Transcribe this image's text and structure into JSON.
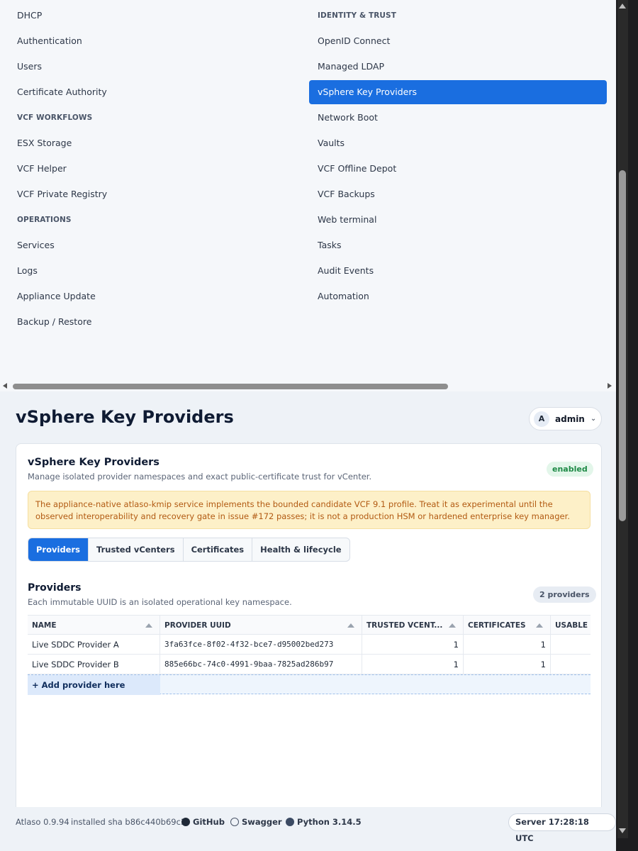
{
  "menu": {
    "left": [
      {
        "label": "DHCP",
        "type": "item"
      },
      {
        "label": "Authentication",
        "type": "item"
      },
      {
        "label": "Users",
        "type": "item"
      },
      {
        "label": "Certificate Authority",
        "type": "item"
      },
      {
        "label": "VCF WORKFLOWS",
        "type": "heading"
      },
      {
        "label": "ESX Storage",
        "type": "item"
      },
      {
        "label": "VCF Helper",
        "type": "item"
      },
      {
        "label": "VCF Private Registry",
        "type": "item"
      },
      {
        "label": "OPERATIONS",
        "type": "heading"
      },
      {
        "label": "Services",
        "type": "item"
      },
      {
        "label": "Logs",
        "type": "item"
      },
      {
        "label": "Appliance Update",
        "type": "item"
      },
      {
        "label": "Backup / Restore",
        "type": "item"
      }
    ],
    "right": [
      {
        "label": "IDENTITY & TRUST",
        "type": "heading"
      },
      {
        "label": "OpenID Connect",
        "type": "item"
      },
      {
        "label": "Managed LDAP",
        "type": "item"
      },
      {
        "label": "vSphere Key Providers",
        "type": "active"
      },
      {
        "label": "Network Boot",
        "type": "item"
      },
      {
        "label": "Vaults",
        "type": "item"
      },
      {
        "label": "VCF Offline Depot",
        "type": "item"
      },
      {
        "label": "VCF Backups",
        "type": "item"
      },
      {
        "label": "Web terminal",
        "type": "item"
      },
      {
        "label": "Tasks",
        "type": "item"
      },
      {
        "label": "Audit Events",
        "type": "item"
      },
      {
        "label": "Automation",
        "type": "item"
      }
    ]
  },
  "header": {
    "title": "vSphere Key Providers",
    "user_initial": "A",
    "user_name": "admin"
  },
  "card": {
    "title": "vSphere Key Providers",
    "subtitle": "Manage isolated provider namespaces and exact public-certificate trust for vCenter.",
    "status": "enabled",
    "warning": "The appliance-native atlaso-kmip service implements the bounded candidate VCF 9.1 profile. Treat it as experimental until the observed interoperability and recovery gate in issue #172 passes; it is not a production HSM or hardened enterprise key manager.",
    "tabs": [
      "Providers",
      "Trusted vCenters",
      "Certificates",
      "Health & lifecycle"
    ],
    "active_tab": 0
  },
  "providers": {
    "title": "Providers",
    "subtitle": "Each immutable UUID is an isolated operational key namespace.",
    "count": "2 providers",
    "columns": [
      "NAME",
      "PROVIDER UUID",
      "TRUSTED VCENT...",
      "CERTIFICATES",
      "USABLE"
    ],
    "rows": [
      [
        "Live SDDC Provider A",
        "3fa63fce-8f02-4f32-bce7-d95002bed273",
        "1",
        "1",
        ""
      ],
      [
        "Live SDDC Provider B",
        "885e66bc-74c0-4991-9baa-7825ad286b97",
        "1",
        "1",
        ""
      ]
    ],
    "add_label": "+ Add provider here"
  },
  "footer": {
    "version": "Atlaso 0.9.94",
    "sha": "installed sha b86c440b69c3",
    "github": "GitHub",
    "swagger": "Swagger",
    "python": "Python 3.14.5",
    "server_time": "Server 17:28:18 UTC"
  },
  "colors": {
    "accent": "#1a6ee0",
    "warning_bg": "#fdf0c8",
    "warning_text": "#b25a12",
    "enabled_bg": "#e3f6ea",
    "enabled_text": "#1e8a46"
  }
}
